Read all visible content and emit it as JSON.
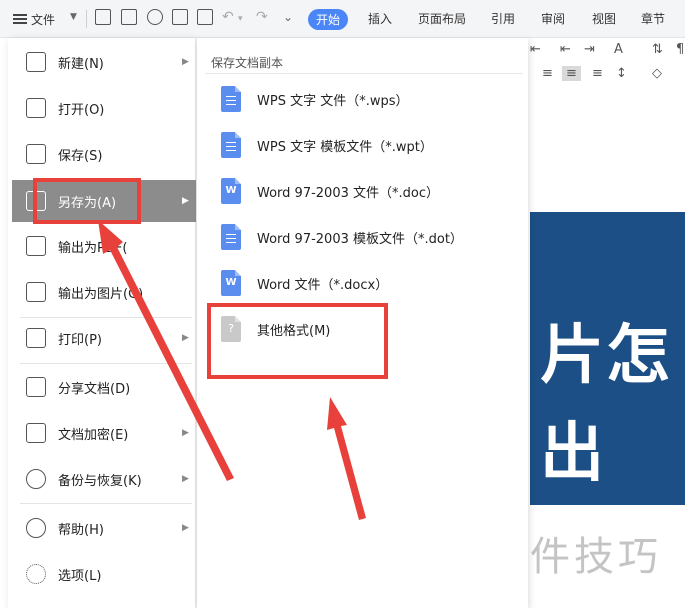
{
  "toolbar": {
    "file_label": "文件",
    "tabs": [
      "开始",
      "插入",
      "页面布局",
      "引用",
      "审阅",
      "视图",
      "章节"
    ],
    "active_tab": "开始"
  },
  "file_menu": {
    "items": [
      {
        "label": "新建(N)",
        "icon": "new-file-icon",
        "has_arrow": true
      },
      {
        "label": "打开(O)",
        "icon": "folder-open-icon",
        "has_arrow": false
      },
      {
        "label": "保存(S)",
        "icon": "save-icon",
        "has_arrow": false
      },
      {
        "label": "另存为(A)",
        "icon": "save-as-icon",
        "has_arrow": true,
        "active": true
      },
      {
        "label": "输出为PDF(",
        "icon": "pdf-export-icon",
        "has_arrow": false
      },
      {
        "label": "输出为图片(G)",
        "icon": "image-export-icon",
        "has_arrow": false
      },
      {
        "label": "打印(P)",
        "icon": "printer-icon",
        "has_arrow": true
      },
      {
        "label": "分享文档(D)",
        "icon": "share-icon",
        "has_arrow": false
      },
      {
        "label": "文档加密(E)",
        "icon": "encrypt-icon",
        "has_arrow": true
      },
      {
        "label": "备份与恢复(K)",
        "icon": "backup-icon",
        "has_arrow": true
      },
      {
        "label": "帮助(H)",
        "icon": "help-icon",
        "has_arrow": true
      },
      {
        "label": "选项(L)",
        "icon": "settings-gear-icon",
        "has_arrow": false
      }
    ]
  },
  "submenu": {
    "title": "保存文档副本",
    "items": [
      {
        "label": "WPS 文字 文件（*.wps）",
        "icon": "wps-doc-icon"
      },
      {
        "label": "WPS 文字 模板文件（*.wpt）",
        "icon": "wps-template-icon"
      },
      {
        "label": "Word 97-2003 文件（*.doc）",
        "icon": "word-doc-icon"
      },
      {
        "label": "Word 97-2003 模板文件（*.dot）",
        "icon": "word-template-icon"
      },
      {
        "label": "Word 文件（*.docx）",
        "icon": "word-docx-icon"
      },
      {
        "label": "其他格式(M)",
        "icon": "other-format-icon"
      }
    ]
  },
  "document": {
    "image_text_line1": "片怎",
    "image_text_line2": "出"
  },
  "watermark": "软件技巧",
  "colors": {
    "accent": "#4a86f7",
    "annotation_red": "#e8413c",
    "active_menu_bg": "#8c8c8c",
    "file_icon_blue": "#5b8def",
    "doc_image_bg": "#1b4f86"
  }
}
